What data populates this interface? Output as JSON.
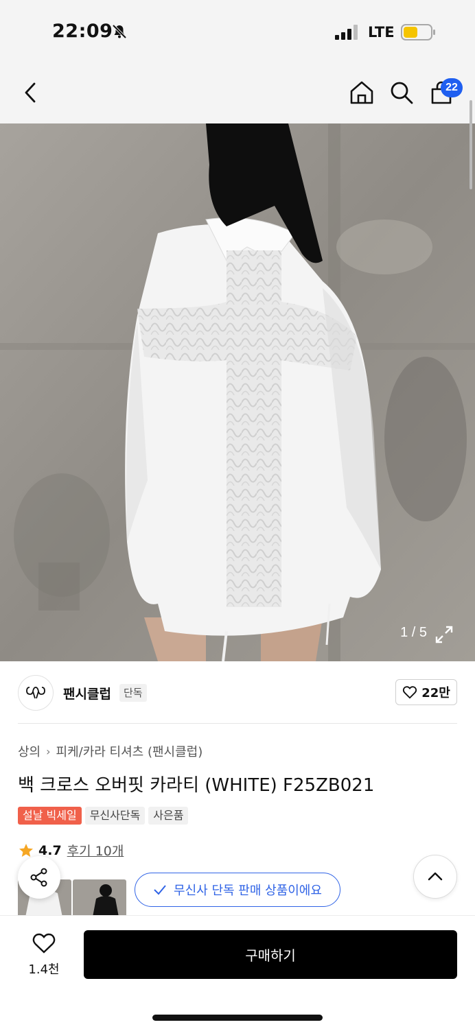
{
  "status_bar": {
    "time": "22:09",
    "network": "LTE",
    "battery_color": "#f5c400"
  },
  "nav": {
    "cart_count": "22",
    "icons": [
      "back-icon",
      "home-icon",
      "search-icon",
      "bag-icon"
    ]
  },
  "hero": {
    "counter": "1 / 5"
  },
  "brand": {
    "name": "팬시클럽",
    "tag": "단독",
    "likes": "22만"
  },
  "breadcrumb": {
    "items": [
      "상의",
      "피케/카라 티셔츠 (팬시클럽)"
    ]
  },
  "product": {
    "title": "백 크로스 오버핏 카라티 (WHITE) F25ZB021",
    "tags": [
      "설날 빅세일",
      "무신사단독",
      "사은품"
    ],
    "rating": "4.7",
    "reviews": "후기 10개",
    "exclusive_note": "무신사 단독 판매 상품이에요"
  },
  "bottom_bar": {
    "wish_count": "1.4천",
    "buy_label": "구매하기"
  },
  "colors": {
    "accent_blue": "#2f63e6",
    "badge_blue": "#1f5ff0",
    "sale_red": "#f0604a",
    "star": "#f5a623"
  }
}
